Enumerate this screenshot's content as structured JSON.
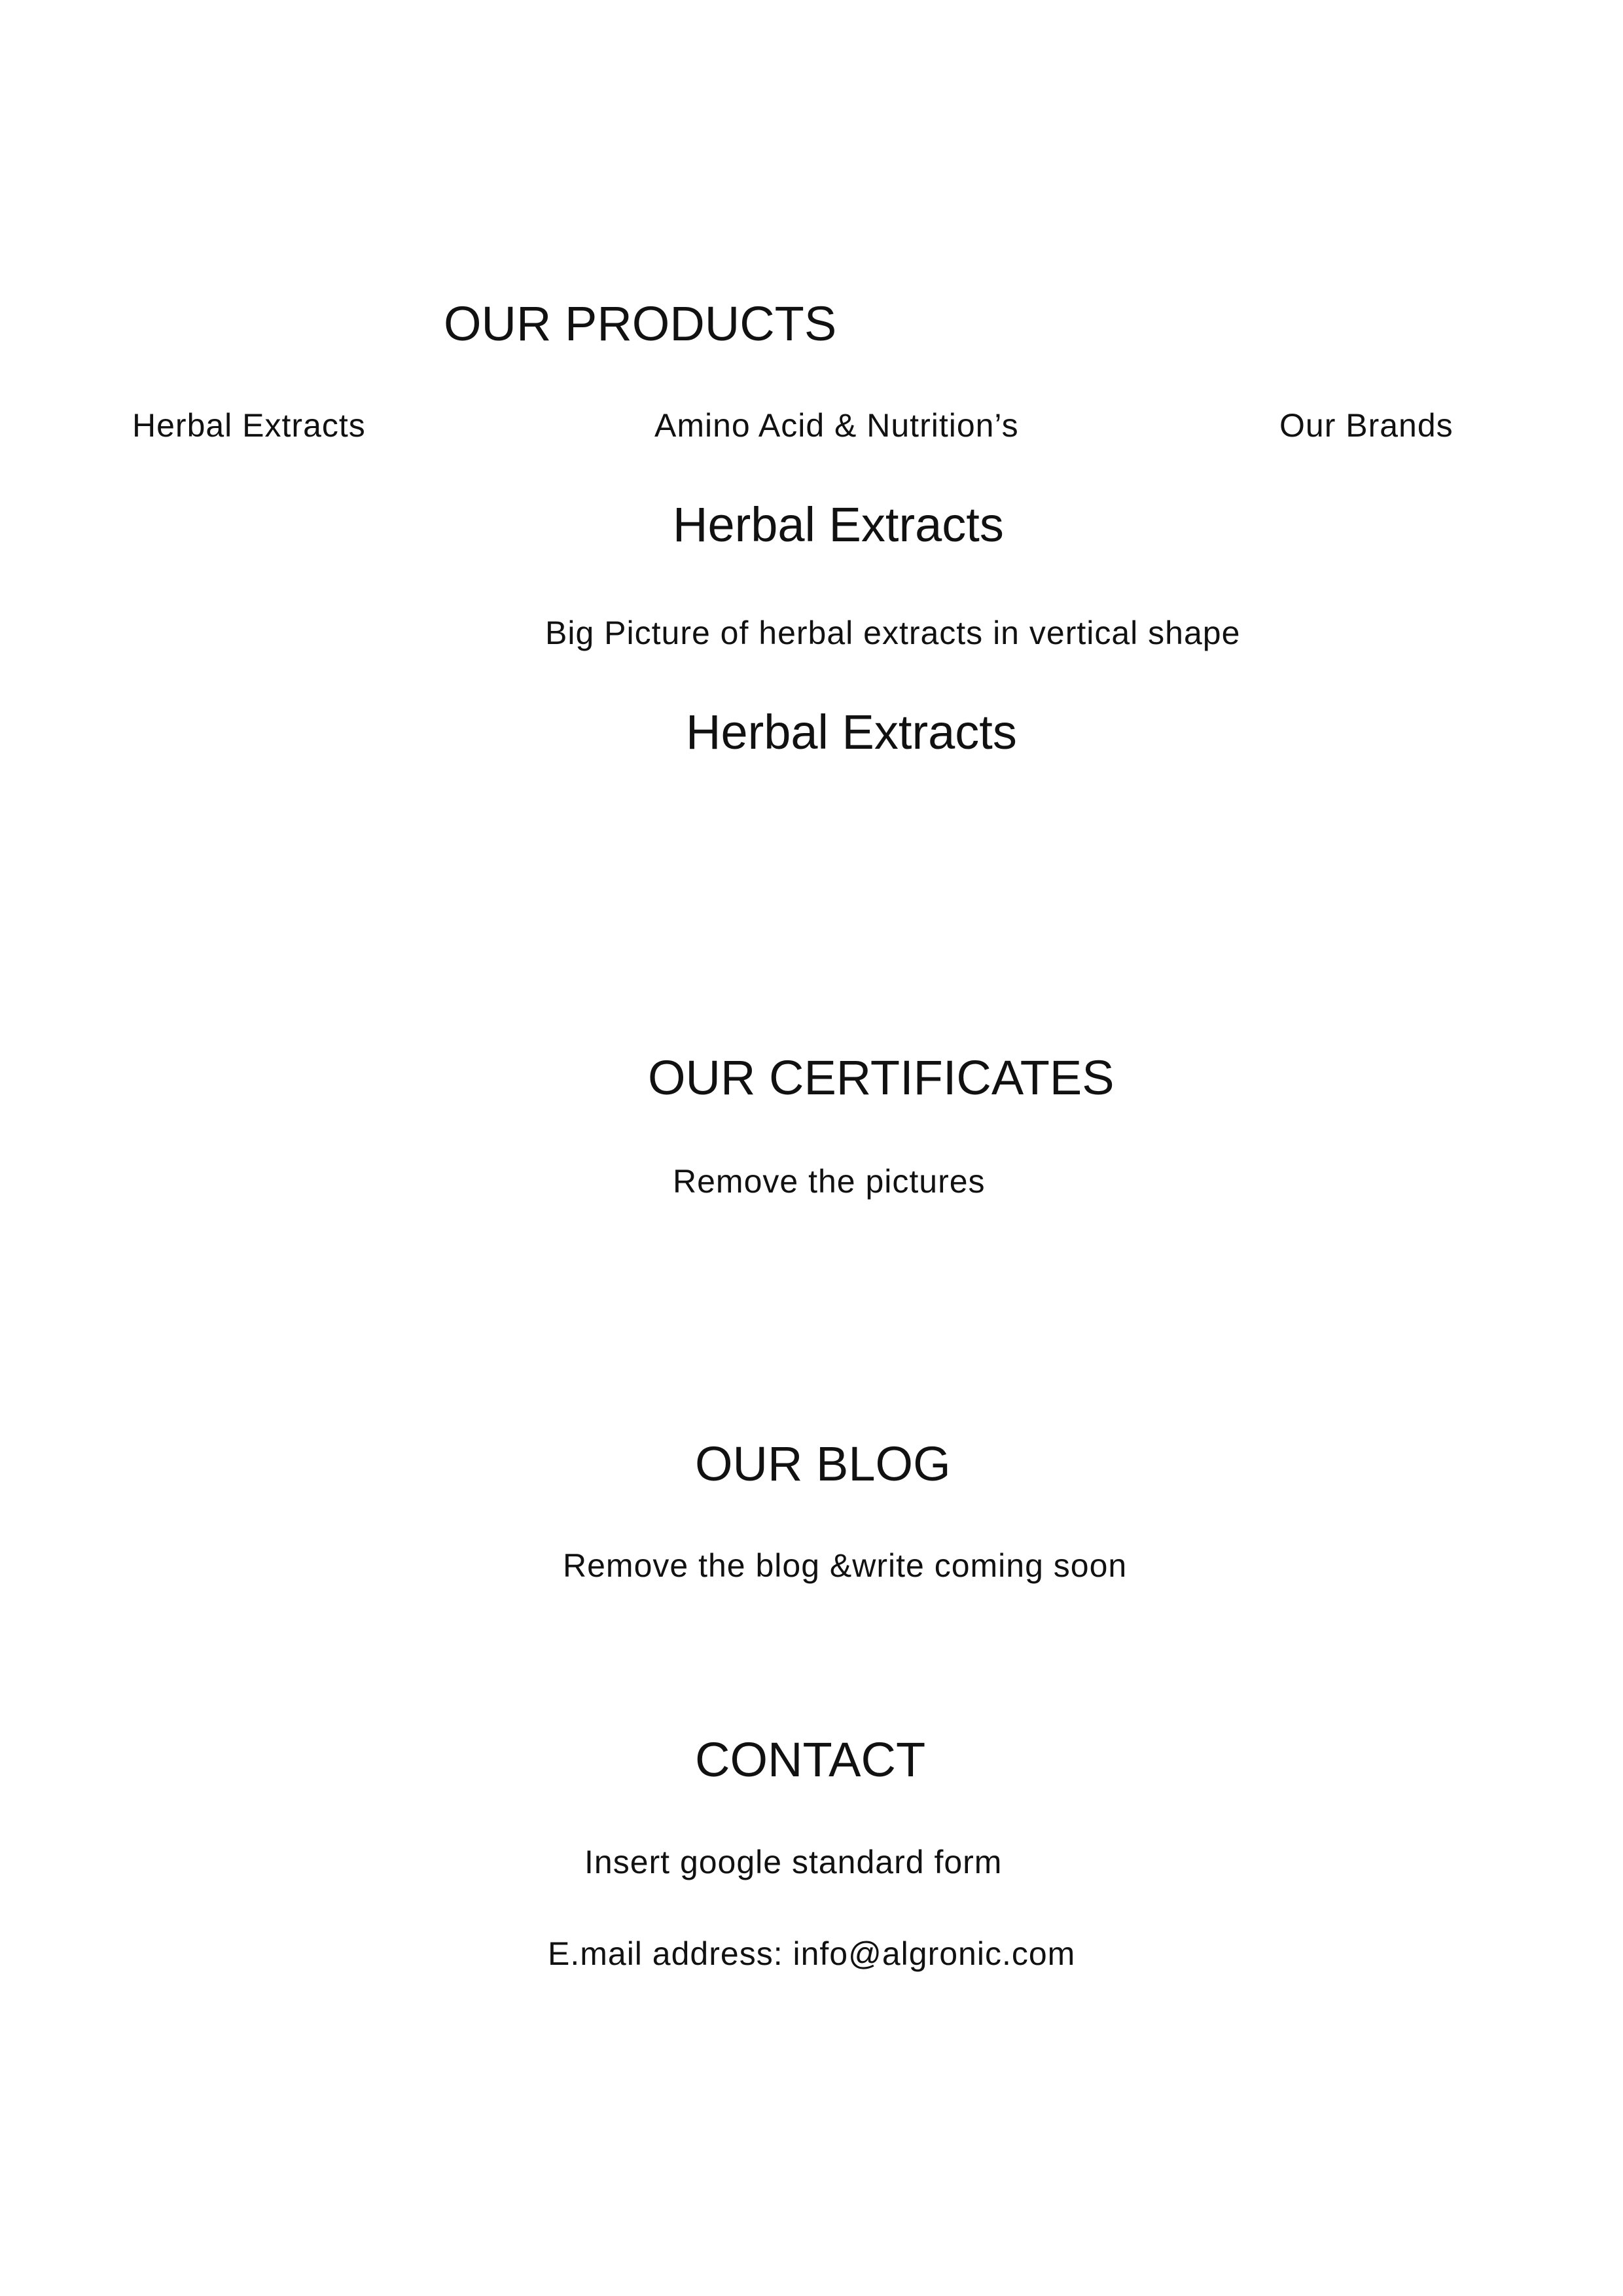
{
  "products": {
    "title": "OUR PRODUCTS",
    "nav": [
      "Herbal Extracts",
      "Amino Acid & Nutrition’s",
      "Our Brands"
    ],
    "heading_1": "Herbal Extracts",
    "note": "Big Picture of herbal extracts in vertical shape",
    "heading_2": "Herbal Extracts"
  },
  "certificates": {
    "title": "OUR CERTIFICATES",
    "note": "Remove the pictures"
  },
  "blog": {
    "title": "OUR BLOG",
    "note": "Remove the blog &write coming soon"
  },
  "contact": {
    "title": "CONTACT",
    "note": "Insert  google standard form",
    "email": "E.mail address: info@algronic.com"
  }
}
